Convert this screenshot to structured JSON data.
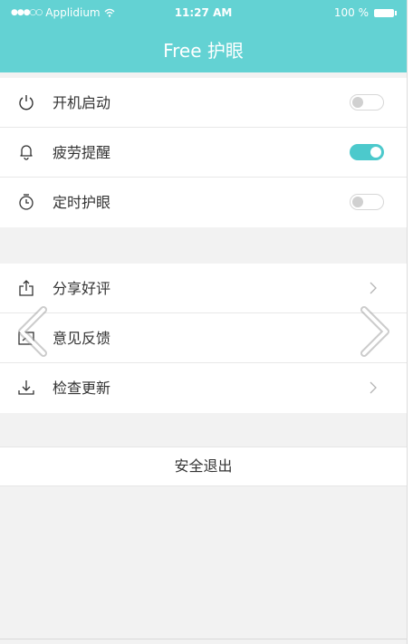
{
  "statusbar": {
    "carrier": "Applidium",
    "time": "11:27 AM",
    "battery": "100 %"
  },
  "header": {
    "title": "Free 护眼"
  },
  "settings": {
    "items": [
      {
        "label": "开机启动",
        "icon": "power-icon",
        "toggle": false
      },
      {
        "label": "疲劳提醒",
        "icon": "bell-icon",
        "toggle": true
      },
      {
        "label": "定时护眼",
        "icon": "timer-icon",
        "toggle": false
      }
    ]
  },
  "actions": {
    "items": [
      {
        "label": "分享好评",
        "icon": "share-icon"
      },
      {
        "label": "意见反馈",
        "icon": "feedback-icon"
      },
      {
        "label": "检查更新",
        "icon": "download-icon"
      }
    ]
  },
  "logout": {
    "label": "安全退出"
  },
  "colors": {
    "accent": "#63d2d3",
    "toggle_on": "#4cc9cc",
    "background": "#f2f2f2"
  }
}
